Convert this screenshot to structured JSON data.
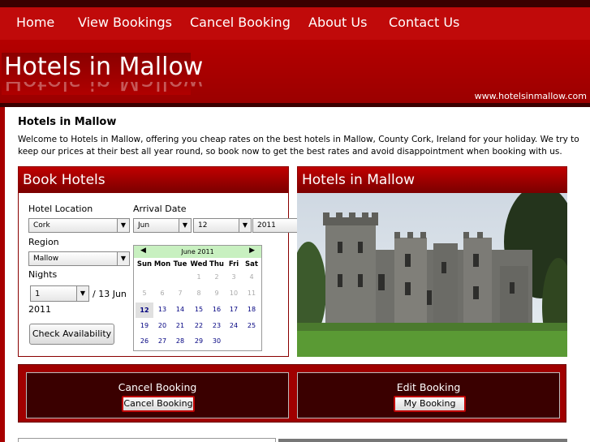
{
  "nav": {
    "items": [
      {
        "label": "Home"
      },
      {
        "label": "View Bookings"
      },
      {
        "label": "Cancel Booking"
      },
      {
        "label": "About Us"
      },
      {
        "label": "Contact Us"
      }
    ]
  },
  "banner": {
    "logo_text": "Hotels in Mallow",
    "url": "www.hotelsinmallow.com"
  },
  "intro": {
    "heading": "Hotels in Mallow",
    "text": "Welcome to Hotels in Mallow, offering you cheap rates on the best hotels in Mallow, County Cork, Ireland for your holiday. We try to keep our prices at their best all year round, so book now to get the best rates and avoid disappointment when booking with us."
  },
  "booking": {
    "title": "Book Hotels",
    "hotel_location_label": "Hotel Location",
    "hotel_location_value": "Cork",
    "arrival_date_label": "Arrival Date",
    "arrival_month": "Jun",
    "arrival_day": "12",
    "arrival_year": "2011",
    "region_label": "Region",
    "region_value": "Mallow",
    "nights_label": "Nights",
    "nights_value": "1",
    "departure_text_a": "/ 13 Jun",
    "departure_text_b": "2011",
    "check_button": "Check Availability"
  },
  "calendar": {
    "title": "June 2011",
    "prev": "◀",
    "next": "▶",
    "weekdays": [
      "Sun",
      "Mon",
      "Tue",
      "Wed",
      "Thu",
      "Fri",
      "Sat"
    ],
    "rows": [
      [
        "",
        "",
        "",
        "1",
        "2",
        "3",
        "4"
      ],
      [
        "5",
        "6",
        "7",
        "8",
        "9",
        "10",
        "11"
      ],
      [
        "12",
        "13",
        "14",
        "15",
        "16",
        "17",
        "18"
      ],
      [
        "19",
        "20",
        "21",
        "22",
        "23",
        "24",
        "25"
      ],
      [
        "26",
        "27",
        "28",
        "29",
        "30",
        "",
        ""
      ]
    ],
    "selected_day": "12"
  },
  "photo_panel": {
    "title": "Hotels in Mallow"
  },
  "lower": {
    "cancel_title": "Cancel Booking",
    "cancel_button": "Cancel Booking",
    "edit_title": "Edit Booking",
    "edit_button": "My Booking"
  },
  "colors": {
    "brand_red": "#c00a0a",
    "dark_red": "#3a0000",
    "calendar_header": "#c8f0c0"
  }
}
